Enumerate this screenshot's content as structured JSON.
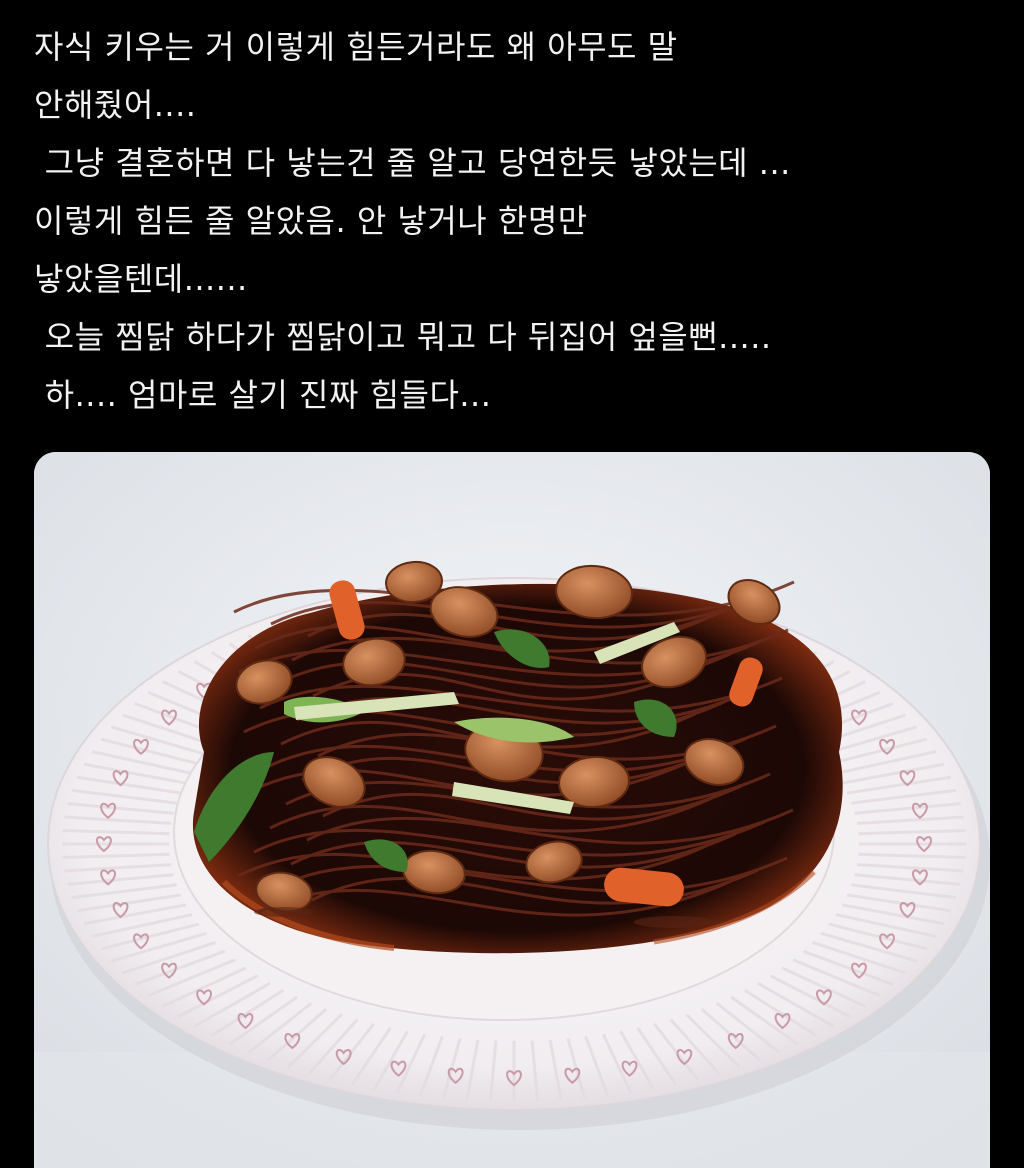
{
  "post": {
    "text_lines": [
      "자식 키우는 거 이렇게 힘든거라도 왜 아무도 말",
      "안해줬어....",
      " 그냥 결혼하면 다 낳는건 줄 알고 당연한듯 낳았는데 ...",
      "이렇게 힘든 줄 알았음. 안 낳거나 한명만",
      "낳았을텐데......",
      " 오늘 찜닭 하다가 찜닭이고 뭐고 다 뒤집어 엎을뻔.....",
      " 하.... 엄마로 살기 진짜 힘들다..."
    ]
  },
  "media": {
    "icon": "jjimdak-photo",
    "colors": {
      "background": "#000000",
      "text": "#f2f2f2",
      "table": "#eceff3",
      "plate": "#f4f2f4",
      "plate_pattern": "#c99aa6",
      "sauce": "#1c0805",
      "chicken": "#b86a3a",
      "noodles": "#6b2a1a",
      "greens": "#3f7a2e",
      "carrot": "#e0622a"
    }
  }
}
